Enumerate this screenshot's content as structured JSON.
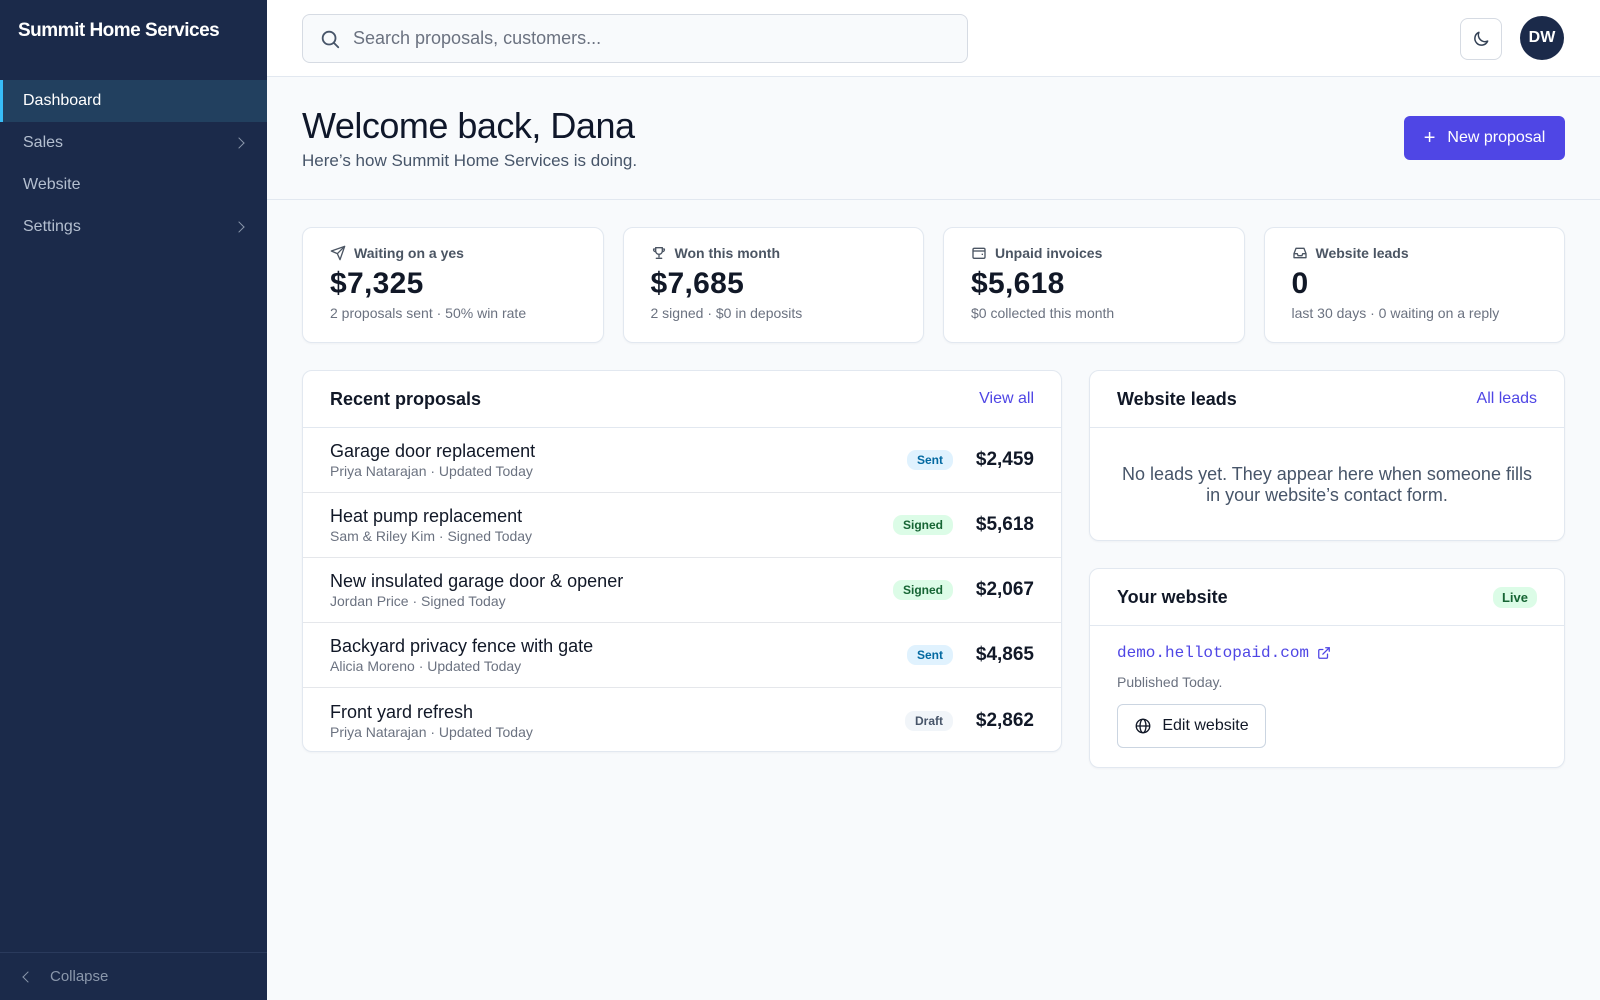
{
  "app": {
    "brand": "Summit Home Services"
  },
  "sidebar": {
    "items": [
      {
        "label": "Dashboard",
        "active": true,
        "has_submenu": false
      },
      {
        "label": "Sales",
        "active": false,
        "has_submenu": true
      },
      {
        "label": "Website",
        "active": false,
        "has_submenu": false
      },
      {
        "label": "Settings",
        "active": false,
        "has_submenu": true
      }
    ],
    "collapse_label": "Collapse"
  },
  "topbar": {
    "search_placeholder": "Search proposals, customers...",
    "user_initials": "DW"
  },
  "header": {
    "title": "Welcome back, Dana",
    "subtitle": "Here’s how Summit Home Services is doing.",
    "new_proposal_label": "New proposal"
  },
  "stats": [
    {
      "icon": "send-icon",
      "label": "Waiting on a yes",
      "value": "$7,325",
      "sub": "2 proposals sent · 50% win rate"
    },
    {
      "icon": "trophy-icon",
      "label": "Won this month",
      "value": "$7,685",
      "sub": "2 signed · $0 in deposits"
    },
    {
      "icon": "wallet-icon",
      "label": "Unpaid invoices",
      "value": "$5,618",
      "sub": "$0 collected this month"
    },
    {
      "icon": "inbox-icon",
      "label": "Website leads",
      "value": "0",
      "sub": "last 30 days · 0 waiting on a reply"
    }
  ],
  "proposals": {
    "title": "Recent proposals",
    "view_all_label": "View all",
    "rows": [
      {
        "name": "Garage door replacement",
        "meta": "Priya Natarajan · Updated Today",
        "status": "Sent",
        "status_key": "sent",
        "amount": "$2,459"
      },
      {
        "name": "Heat pump replacement",
        "meta": "Sam & Riley Kim · Signed Today",
        "status": "Signed",
        "status_key": "signed",
        "amount": "$5,618"
      },
      {
        "name": "New insulated garage door & opener",
        "meta": "Jordan Price · Signed Today",
        "status": "Signed",
        "status_key": "signed",
        "amount": "$2,067"
      },
      {
        "name": "Backyard privacy fence with gate",
        "meta": "Alicia Moreno · Updated Today",
        "status": "Sent",
        "status_key": "sent",
        "amount": "$4,865"
      },
      {
        "name": "Front yard refresh",
        "meta": "Priya Natarajan · Updated Today",
        "status": "Draft",
        "status_key": "draft",
        "amount": "$2,862"
      }
    ]
  },
  "leads": {
    "title": "Website leads",
    "all_leads_label": "All leads",
    "empty_text": "No leads yet. They appear here when someone fills in your website’s contact form."
  },
  "website": {
    "title": "Your website",
    "status": "Live",
    "url": "demo.hellotopaid.com",
    "published": "Published Today.",
    "edit_label": "Edit website"
  },
  "colors": {
    "sidebar_bg": "#1b2a4a",
    "accent": "#4f46e5",
    "active_indicator": "#38bdf8"
  }
}
